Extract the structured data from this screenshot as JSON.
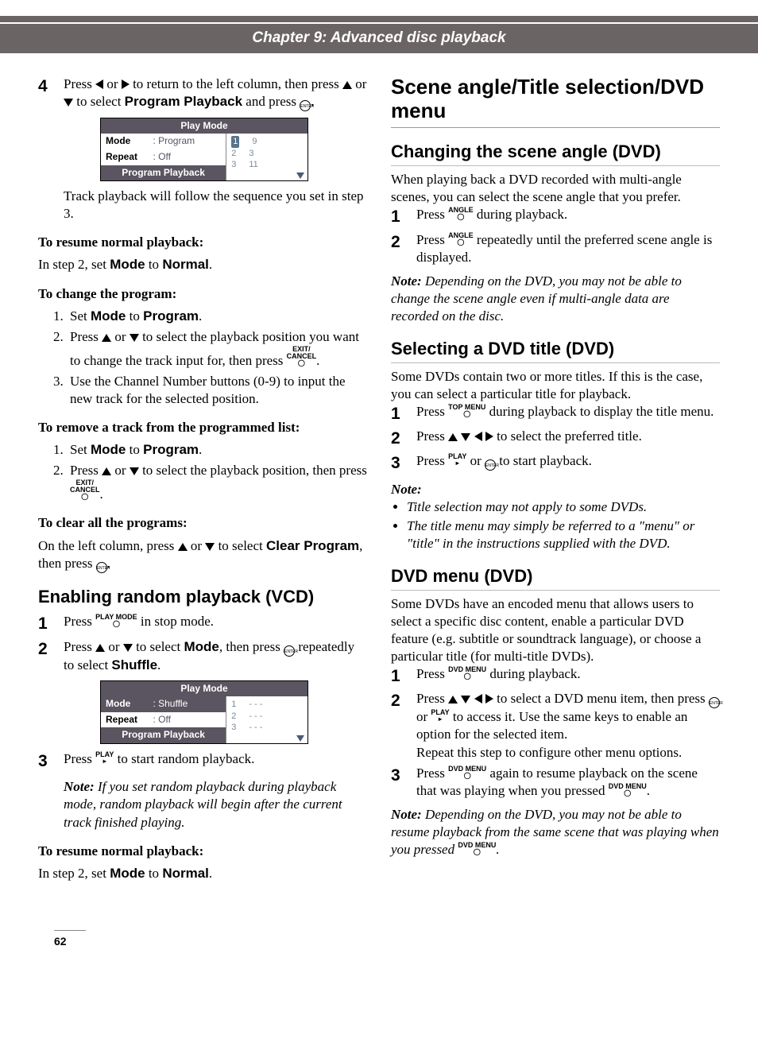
{
  "chapter_title": "Chapter 9: Advanced disc playback",
  "left": {
    "step4": {
      "num": "4",
      "text_a": "Press ",
      "text_b": " or ",
      "text_c": " to return to the left column, then press ",
      "text_d": " or ",
      "text_e": " to select ",
      "label_pp": "Program Playback",
      "text_f": " and press ",
      "text_g": "."
    },
    "panel1": {
      "title": "Play Mode",
      "row1_lab": "Mode",
      "row1_val": ": Program",
      "row2_lab": "Repeat",
      "row2_val": ": Off",
      "foot": "Program Playback",
      "r1a": "1",
      "r1b": "9",
      "r2a": "2",
      "r2b": "3",
      "r3a": "3",
      "r3b": "11"
    },
    "after_panel1": "Track playback will follow the sequence you set in step 3.",
    "resume_head": "To resume normal playback:",
    "resume_body_a": "In step 2, set ",
    "resume_mode": "Mode",
    "resume_body_b": " to ",
    "resume_normal": "Normal",
    "resume_body_c": ".",
    "change_head": "To change the program:",
    "change_li1_a": "Set ",
    "change_li1_mode": "Mode",
    "change_li1_b": " to ",
    "change_li1_prog": "Program",
    "change_li1_c": ".",
    "change_li2_a": "Press ",
    "change_li2_b": " or ",
    "change_li2_c": " to select the playback position you want to change the track input for, then press ",
    "change_li2_btn": "EXIT/\nCANCEL",
    "change_li2_d": ".",
    "change_li3": "Use the Channel Number buttons (0-9) to input the new track for the selected position.",
    "remove_head": "To remove a track from the programmed list:",
    "remove_li1_a": "Set ",
    "remove_li1_mode": "Mode",
    "remove_li1_b": " to ",
    "remove_li1_prog": "Program",
    "remove_li1_c": ".",
    "remove_li2_a": "Press ",
    "remove_li2_b": " or ",
    "remove_li2_c": " to select the playback position, then press ",
    "remove_li2_btn": "EXIT/\nCANCEL",
    "remove_li2_d": ".",
    "clear_head": "To clear all the programs:",
    "clear_body_a": "On the left column, press ",
    "clear_body_b": " or ",
    "clear_body_c": " to select ",
    "clear_label_clear": "Clear Program",
    "clear_body_d": ", then press ",
    "clear_body_e": ".",
    "random_h2": "Enabling random playback (VCD)",
    "r_step1_num": "1",
    "r_step1_a": "Press ",
    "r_step1_btn": "PLAY MODE",
    "r_step1_b": " in stop mode.",
    "r_step2_num": "2",
    "r_step2_a": "Press ",
    "r_step2_b": " or ",
    "r_step2_c": " to select ",
    "r_step2_mode": "Mode",
    "r_step2_d": ", then press ",
    "r_step2_e": " repeatedly to select ",
    "r_step2_shuffle": "Shuffle",
    "r_step2_f": ".",
    "panel2": {
      "title": "Play Mode",
      "row1_lab": "Mode",
      "row1_val": ": Shuffle",
      "row2_lab": "Repeat",
      "row2_val": ": Off",
      "foot": "Program Playback",
      "r1a": "1",
      "r1b": "- - -",
      "r2a": "2",
      "r2b": "- - -",
      "r3a": "3",
      "r3b": "- - -"
    },
    "r_step3_num": "3",
    "r_step3_a": "Press ",
    "r_step3_btn": "PLAY",
    "r_step3_b": " to start random playback.",
    "r_note_label": "Note:",
    "r_note_body": " If you set random playback during playback mode, random playback will begin after the current track finished playing.",
    "resume2_head": "To resume normal playback:",
    "resume2_body_a": "In step 2, set ",
    "resume2_mode": "Mode",
    "resume2_body_b": " to ",
    "resume2_normal": "Normal",
    "resume2_body_c": "."
  },
  "right": {
    "h1": "Scene angle/Title selection/DVD menu",
    "s1_h2": "Changing the scene angle (DVD)",
    "s1_intro": "When playing back a DVD recorded with multi-angle scenes, you can select the scene angle that you prefer.",
    "s1_1num": "1",
    "s1_1a": "Press ",
    "s1_1btn": "ANGLE",
    "s1_1b": " during playback.",
    "s1_2num": "2",
    "s1_2a": "Press ",
    "s1_2btn": "ANGLE",
    "s1_2b": " repeatedly until the preferred scene angle is displayed.",
    "s1_note_label": "Note:",
    "s1_note_body": " Depending on the DVD, you may not be able to change the scene angle even if multi-angle data are recorded on the disc.",
    "s2_h2": "Selecting a DVD title (DVD)",
    "s2_intro": "Some DVDs contain two or more titles. If this is the case, you can select a particular title for playback.",
    "s2_1num": "1",
    "s2_1a": "Press ",
    "s2_1btn": "TOP MENU",
    "s2_1b": " during playback to display the title menu.",
    "s2_2num": "2",
    "s2_2a": "Press ",
    "s2_2b": " to select the preferred title.",
    "s2_3num": "3",
    "s2_3a": "Press ",
    "s2_3btn": "PLAY",
    "s2_3b": " or ",
    "s2_3c": " to start playback.",
    "s2_note_head": "Note:",
    "s2_bullet1": "Title selection may not apply to some DVDs.",
    "s2_bullet2": "The title menu may simply be referred to a \"menu\" or \"title\" in the instructions supplied with the DVD.",
    "s3_h2": "DVD menu (DVD)",
    "s3_intro": "Some DVDs have an encoded menu that allows users to select a specific disc content, enable a particular DVD feature (e.g. subtitle or soundtrack language), or choose a particular title (for multi-title DVDs).",
    "s3_1num": "1",
    "s3_1a": "Press ",
    "s3_1btn": "DVD MENU",
    "s3_1b": " during playback.",
    "s3_2num": "2",
    "s3_2a": "Press ",
    "s3_2b": " to select a DVD menu item, then press ",
    "s3_2c": " or ",
    "s3_2btn": "PLAY",
    "s3_2d": " to access it. Use the same keys to enable an option for the selected item.",
    "s3_2e": "Repeat this step to configure other menu options.",
    "s3_3num": "3",
    "s3_3a": "Press ",
    "s3_3btn": "DVD MENU",
    "s3_3b": " again to resume playback on the scene that was playing when you pressed ",
    "s3_3btn2": "DVD MENU",
    "s3_3c": ".",
    "s3_note_label": "Note:",
    "s3_note_body_a": " Depending on the DVD, you may not be able to resume playback from the same scene that was playing when you pressed ",
    "s3_note_btn": "DVD MENU",
    "s3_note_body_b": "."
  },
  "page_number": "62"
}
